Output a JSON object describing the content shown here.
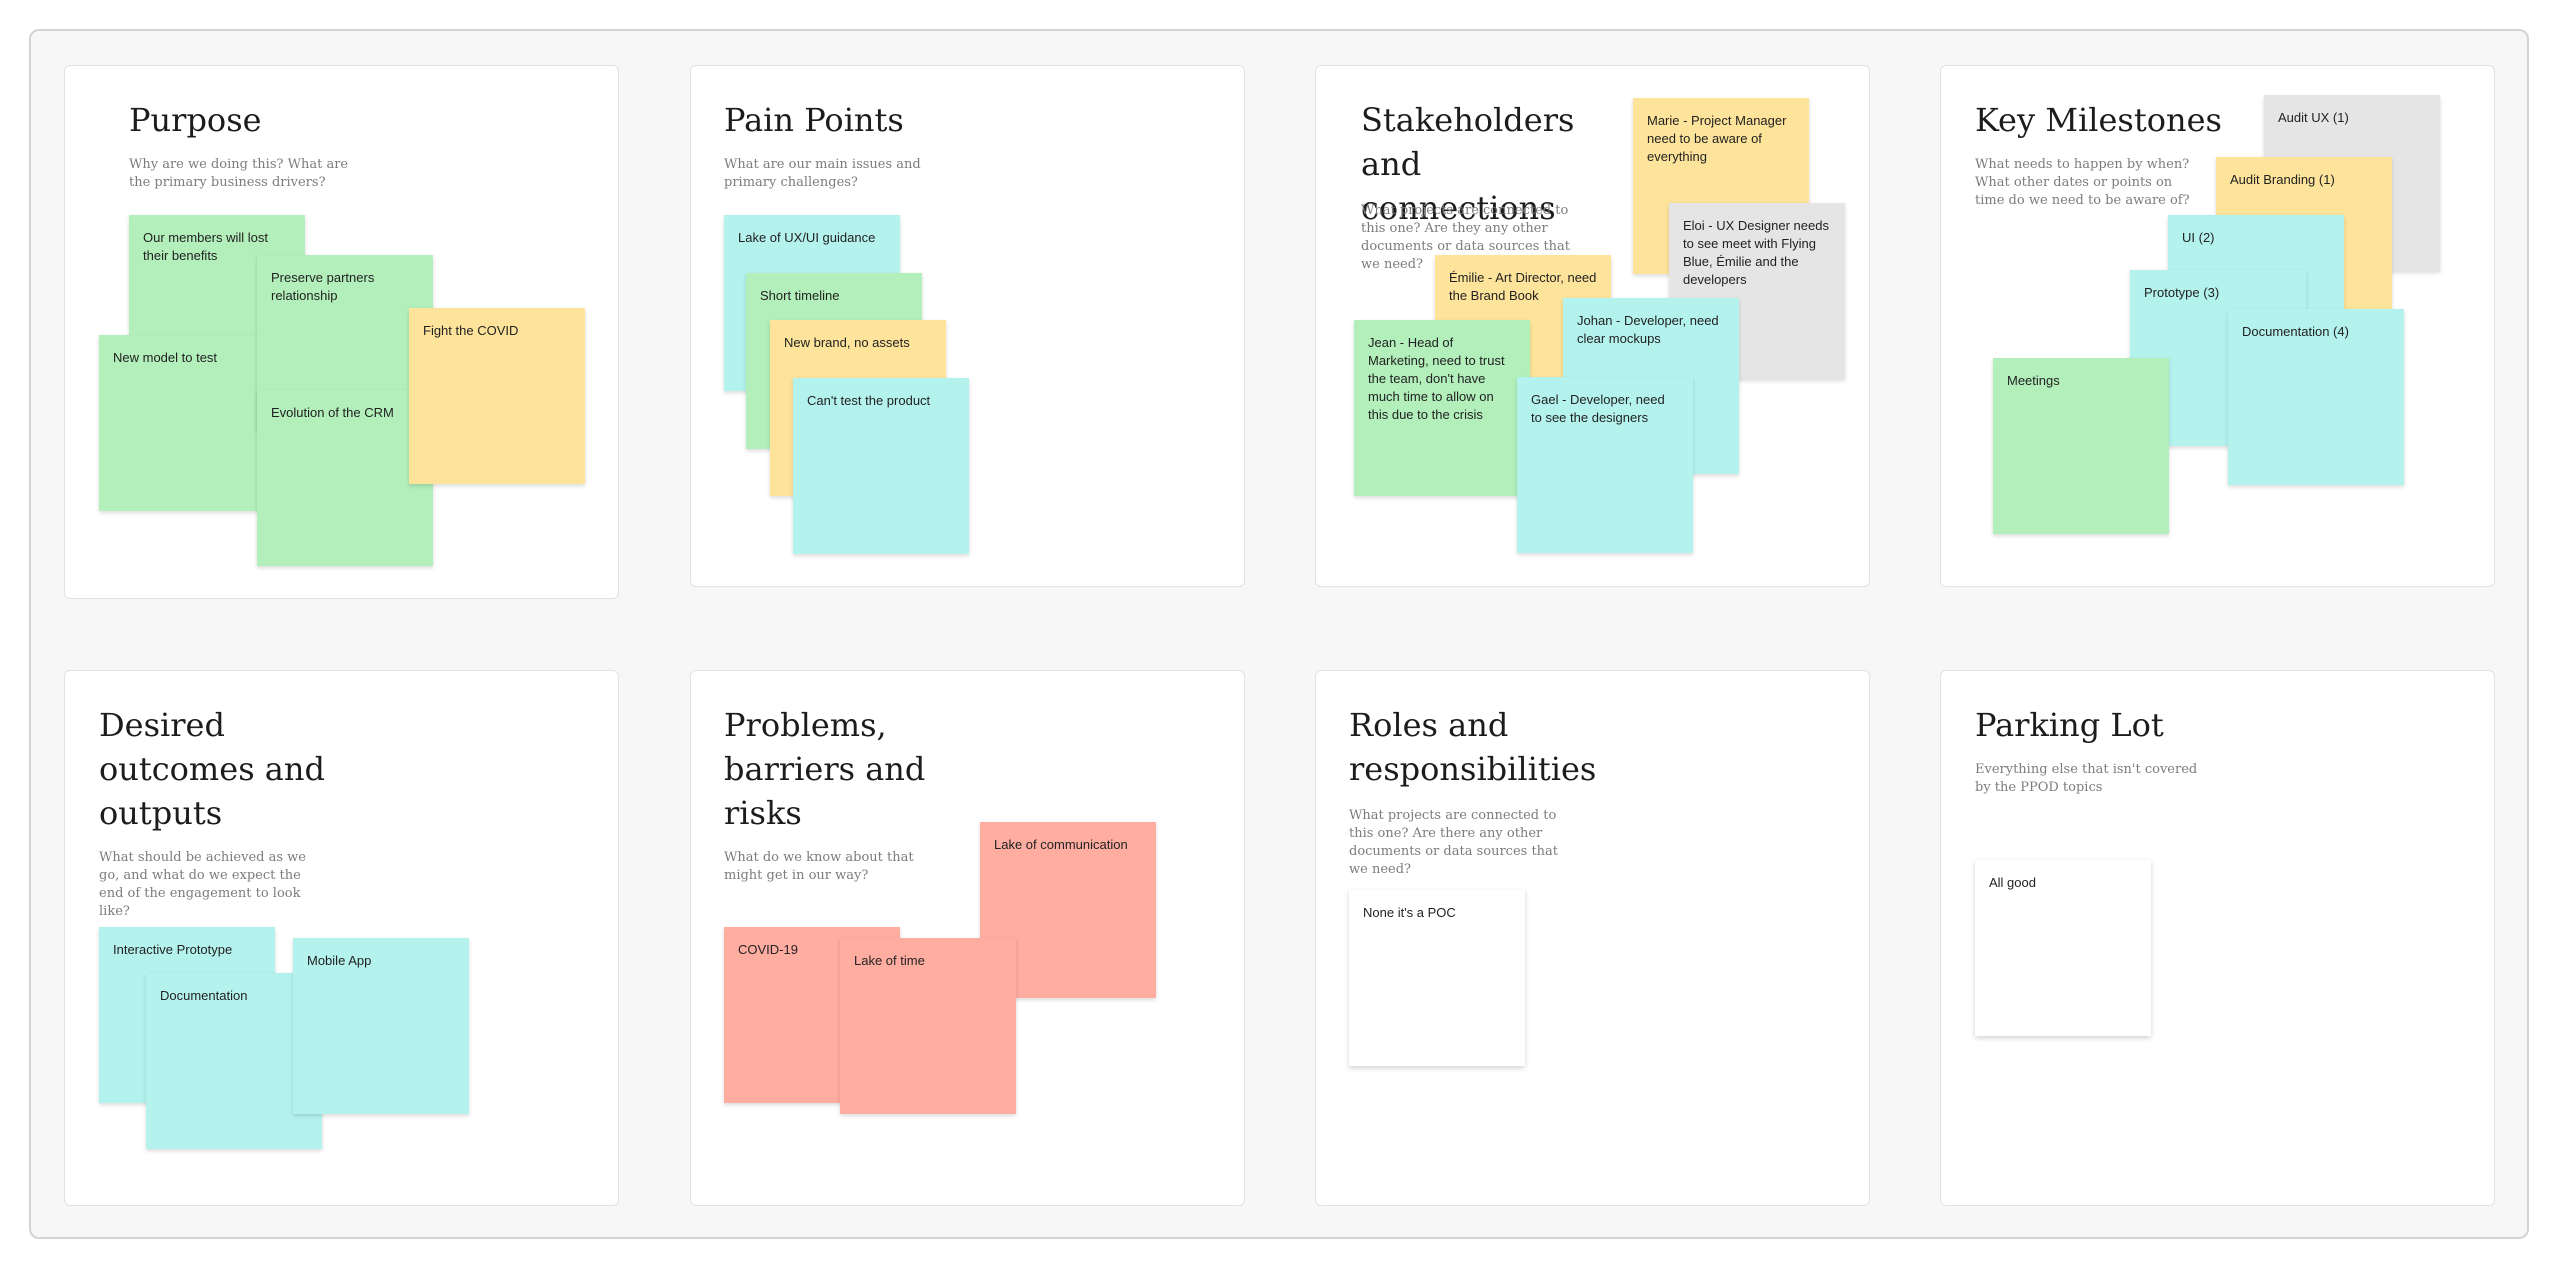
{
  "sections": {
    "purpose": {
      "title": "Purpose",
      "description": "Why are we doing this? What are the primary business drivers?",
      "notes": [
        "Our members will lost their benefits",
        "Preserve partners relationship",
        "New model to test",
        "Evolution of the CRM",
        "Fight the COVID"
      ]
    },
    "pain_points": {
      "title": "Pain Points",
      "description": "What are our main issues and primary challenges?",
      "notes": [
        "Lake of UX/UI guidance",
        "Short timeline",
        "New brand, no assets",
        "Can't test the product"
      ]
    },
    "stakeholders": {
      "title": "Stakeholders and connections",
      "description": "What projects are connected to this one? Are they any other documents or data sources that we need?",
      "notes": [
        "Marie - Project Manager need to be aware of everything",
        "Eloi - UX Designer needs to see meet with Flying Blue, Émilie and the developers",
        "Émilie - Art Director, need the Brand Book",
        "Johan - Developer, need clear mockups",
        "Jean - Head of Marketing, need to trust the team, don't have much time to allow on this due to the crisis",
        "Gael - Developer, need to see the designers"
      ]
    },
    "milestones": {
      "title": "Key Milestones",
      "description": "What needs to happen by when? What other dates or points on time do we need to be aware of?",
      "notes": [
        "Audit UX (1)",
        "Audit Branding (1)",
        "UI (2)",
        "Prototype (3)",
        "Documentation (4)",
        "Meetings"
      ]
    },
    "outcomes": {
      "title": "Desired outcomes and outputs",
      "description": "What should be achieved as we go, and what do we expect the end of the engagement to look like?",
      "notes": [
        "Interactive Prototype",
        "Documentation",
        "Mobile App"
      ]
    },
    "problems": {
      "title": "Problems, barriers and risks",
      "description": "What do we know about that might get in our way?",
      "notes": [
        "Lake of communication",
        "COVID-19",
        "Lake of time"
      ]
    },
    "roles": {
      "title": "Roles and responsibilities",
      "description": "What projects are connected to this one? Are there any other documents or data sources that we need?",
      "notes": [
        "None it's a POC"
      ]
    },
    "parking": {
      "title": "Parking Lot",
      "description": "Everything else that isn't covered by the PPOD topics",
      "notes": [
        "All good"
      ]
    }
  },
  "colors": {
    "green": "#b2efbb",
    "yellow": "#fee39a",
    "cyan": "#b4f2ee",
    "gray": "#e5e5e5",
    "red": "#ffaca1",
    "white": "#ffffff"
  }
}
